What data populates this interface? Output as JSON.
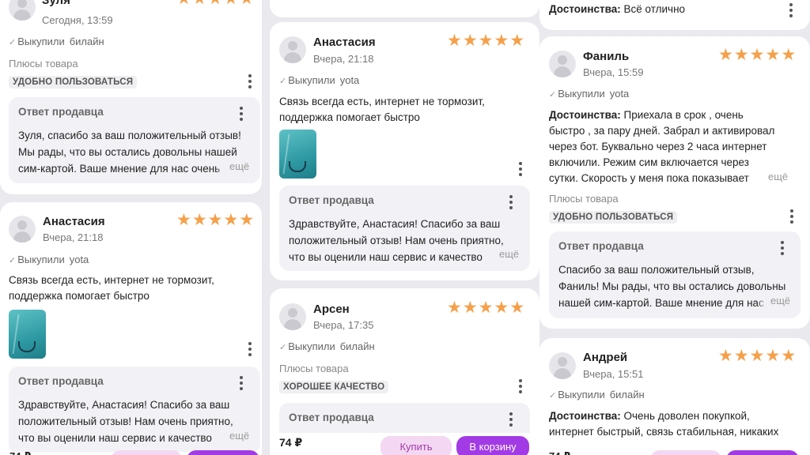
{
  "common": {
    "reply_title": "Ответ продавца",
    "bought_label": "Выкупили",
    "more_label": "ещё",
    "plus_label": "Плюсы товара",
    "price": "74 ₽",
    "buy_now_label": "Купить",
    "cart_label": "В корзину",
    "star_color": "#f5a04a",
    "accent_color": "#a23be5"
  },
  "col1": {
    "r1": {
      "name": "Зуля",
      "date": "Сегодня, 13:59",
      "carrier": "билайн",
      "tag": "УДОБНО ПОЛЬЗОВАТЬСЯ",
      "reply": [
        "Зуля, спасибо за ваш положительный отзыв!",
        "Мы рады, что вы остались довольны нашей",
        "сим-картой. Ваше мнение для нас очень"
      ]
    },
    "r2": {
      "name": "Анастасия",
      "date": "Вчера, 21:18",
      "carrier": "yota",
      "text": [
        "Связь всегда есть, интернет не тормозит,",
        "поддержка помогает быстро"
      ],
      "reply": [
        "Здравствуйте, Анастасия! Спасибо за ваш",
        "положительный отзыв! Нам очень приятно,",
        "что вы оценили наш сервис и качество"
      ]
    }
  },
  "col2": {
    "r1": {
      "name": "Анастасия",
      "date": "Вчера, 21:18",
      "carrier": "yota",
      "text": [
        "Связь всегда есть, интернет не тормозит,",
        "поддержка помогает быстро"
      ],
      "reply": [
        "Здравствуйте, Анастасия! Спасибо за ваш",
        "положительный отзыв! Нам очень приятно,",
        "что вы оценили наш сервис и качество"
      ]
    },
    "r2": {
      "name": "Арсен",
      "date": "Вчера, 17:35",
      "carrier": "билайн",
      "tag": "ХОРОШЕЕ КАЧЕСТВО"
    }
  },
  "col3": {
    "r0": {
      "label": "Достоинства:",
      "text": "Всё отлично"
    },
    "r1": {
      "name": "Фаниль",
      "date": "Вчера, 15:59",
      "carrier": "yota",
      "label": "Достоинства:",
      "text": [
        "Приехала в срок , очень",
        "быстро , за пару дней. Забрал и активировал",
        "через бот. Буквально через 2 часа интернет",
        "включили. Режим сим включается через",
        "сутки. Скорость у меня пока показывает"
      ],
      "tag": "УДОБНО ПОЛЬЗОВАТЬСЯ",
      "reply": [
        "Спасибо за ваш положительный отзыв,",
        "Фаниль! Мы рады, что вы остались довольны",
        "нашей сим-картой. Ваше мнение для нас"
      ]
    },
    "r2": {
      "name": "Андрей",
      "date": "Вчера, 15:51",
      "carrier": "билайн",
      "label": "Достоинства:",
      "text": [
        "Очень доволен покупкой,",
        "интернет быстрый, связь стабильная, никаких"
      ]
    }
  }
}
